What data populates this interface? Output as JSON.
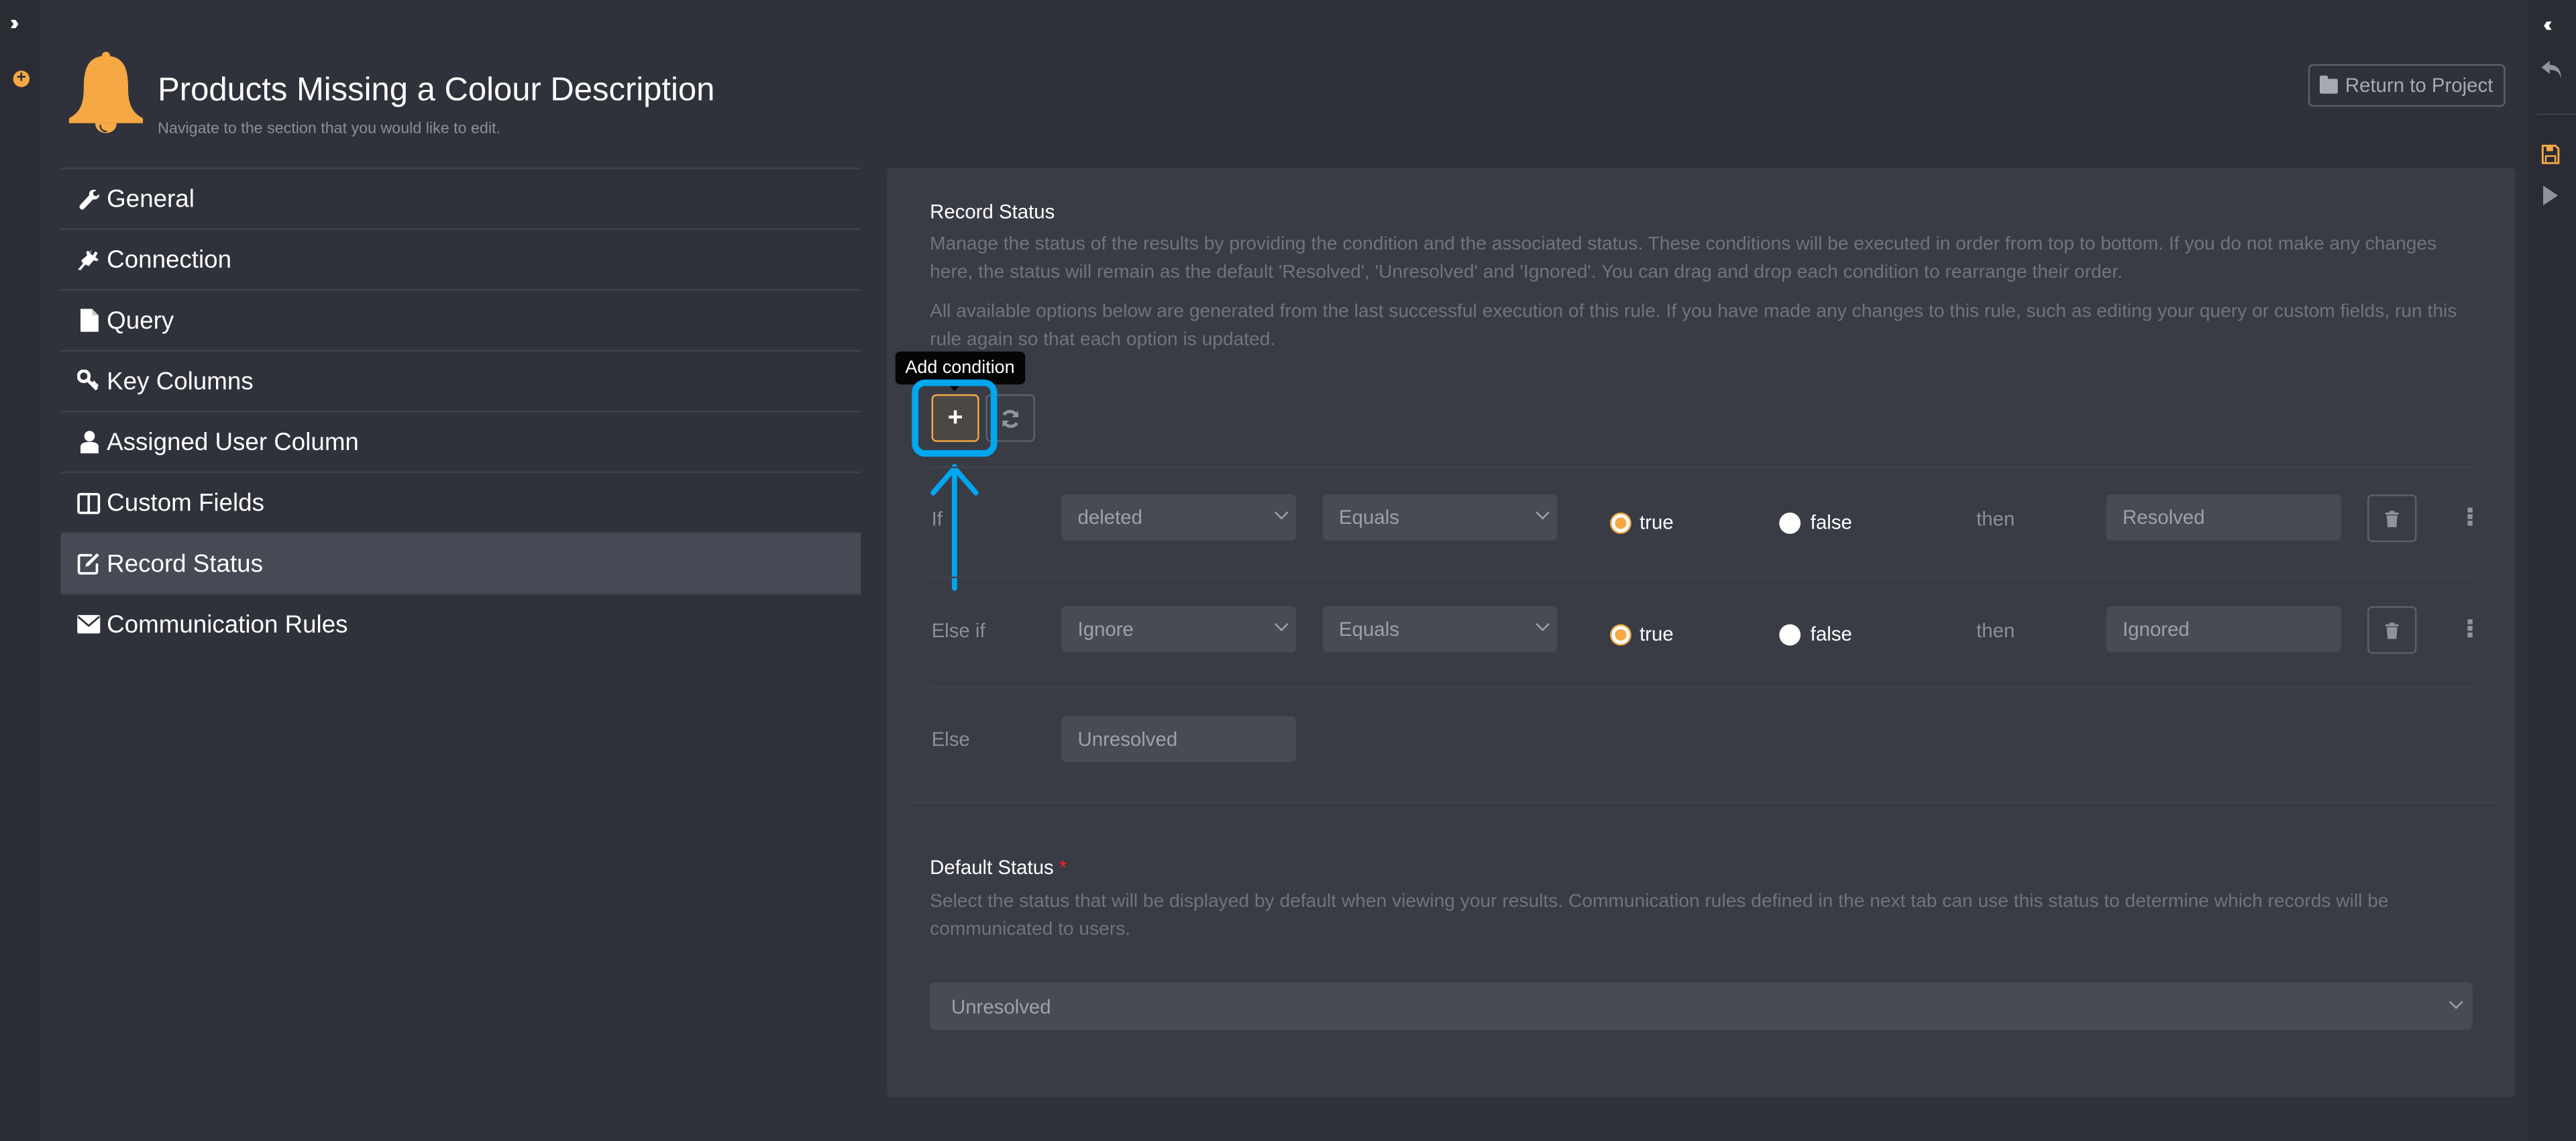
{
  "header": {
    "title": "Products Missing a Colour Description",
    "subtitle": "Navigate to the section that you would like to edit.",
    "return_button": "Return to Project"
  },
  "colors": {
    "accent": "#f5a843",
    "annotation": "#00a6ef",
    "required": "#ff2020"
  },
  "sidebar": {
    "items": [
      {
        "label": "General",
        "icon": "wrench-icon",
        "active": false
      },
      {
        "label": "Connection",
        "icon": "plug-icon",
        "active": false
      },
      {
        "label": "Query",
        "icon": "file-icon",
        "active": false
      },
      {
        "label": "Key Columns",
        "icon": "key-icon",
        "active": false
      },
      {
        "label": "Assigned User Column",
        "icon": "user-icon",
        "active": false
      },
      {
        "label": "Custom Fields",
        "icon": "columns-icon",
        "active": false
      },
      {
        "label": "Record Status",
        "icon": "edit-icon",
        "active": true
      },
      {
        "label": "Communication Rules",
        "icon": "envelope-icon",
        "active": false
      }
    ]
  },
  "right_rail": {
    "icons": [
      "collapse-icon",
      "undo-icon",
      "save-icon",
      "run-icon"
    ]
  },
  "record_status": {
    "title": "Record Status",
    "help1": "Manage the status of the results by providing the condition and the associated status. These conditions will be executed in order from top to bottom. If you do not make any changes here, the status will remain as the default 'Resolved', 'Unresolved' and 'Ignored'. You can drag and drop each condition to rearrange their order.",
    "help2": "All available options below are generated from the last successful execution of this rule. If you have made any changes to this rule, such as editing your query or custom fields, run this rule again so that each option is updated.",
    "tooltip": "Add condition",
    "add_button": "+",
    "conditions": [
      {
        "label": "If",
        "field": "deleted",
        "operator": "Equals",
        "true_label": "true",
        "false_label": "false",
        "selected": "true",
        "then": "then",
        "status": "Resolved"
      },
      {
        "label": "Else if",
        "field": "Ignore",
        "operator": "Equals",
        "true_label": "true",
        "false_label": "false",
        "selected": "true",
        "then": "then",
        "status": "Ignored"
      }
    ],
    "else": {
      "label": "Else",
      "status": "Unresolved"
    }
  },
  "default_status": {
    "label": "Default Status",
    "required_mark": "*",
    "help": "Select the status that will be displayed by default when viewing your results. Communication rules defined in the next tab can use this status to determine which records will be communicated to users.",
    "value": "Unresolved"
  }
}
